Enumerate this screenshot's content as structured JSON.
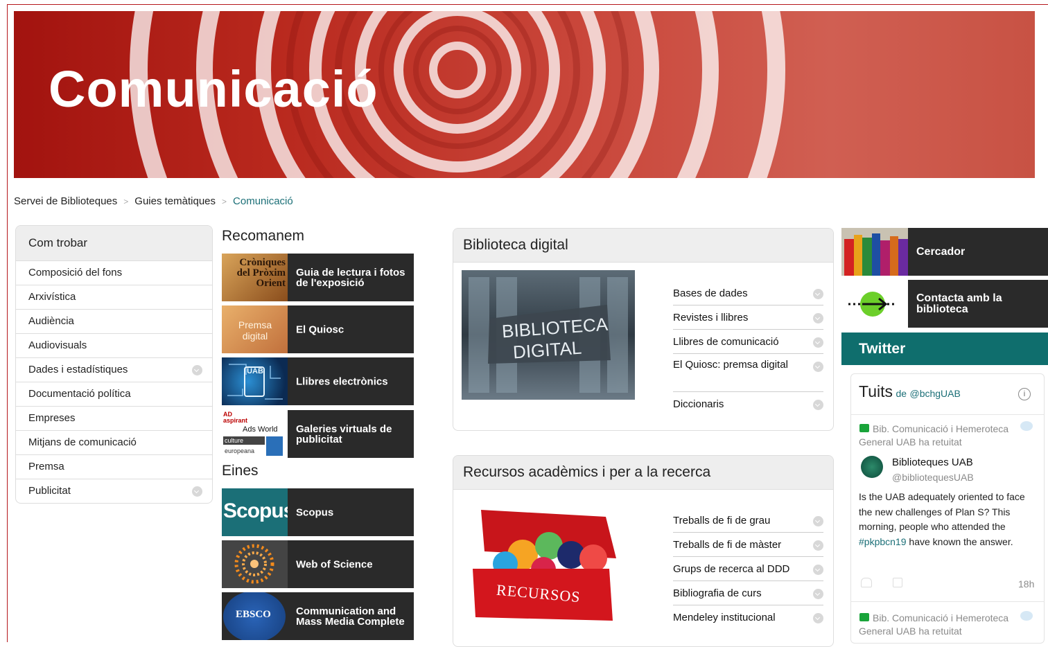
{
  "banner": {
    "title": "Comunicació"
  },
  "breadcrumb": {
    "items": [
      "Servei de Biblioteques",
      "Guies temàtiques",
      "Comunicació"
    ]
  },
  "sidebar": {
    "heading": "Com trobar",
    "items": [
      {
        "label": "Composició del fons",
        "expandable": false
      },
      {
        "label": "Arxivística",
        "expandable": false
      },
      {
        "label": "Audiència",
        "expandable": false
      },
      {
        "label": "Audiovisuals",
        "expandable": false
      },
      {
        "label": "Dades i estadístiques",
        "expandable": true
      },
      {
        "label": "Documentació política",
        "expandable": false
      },
      {
        "label": "Empreses",
        "expandable": false
      },
      {
        "label": "Mitjans de comunicació",
        "expandable": false
      },
      {
        "label": "Premsa",
        "expandable": false
      },
      {
        "label": "Publicitat",
        "expandable": true
      }
    ]
  },
  "recomanem": {
    "heading": "Recomanem",
    "thumb_text": [
      "Cròniques del Pròxim Orient",
      "Premsa digital",
      "UAB"
    ],
    "tiles": [
      "Guia de lectura i fotos de l'exposició",
      "El Quiosc",
      "Llibres electrònics",
      "Galeries virtuals de publicitat"
    ]
  },
  "galeries_thumb": [
    "AD aspirant",
    "Ads World",
    "culture",
    "europeana"
  ],
  "eines": {
    "heading": "Eines",
    "scopus_logo": "Scopus",
    "ebsco_logo": "EBSCO",
    "tiles": [
      "Scopus",
      "Web of Science",
      "Communication and Mass Media Complete"
    ]
  },
  "biblioteca_digital": {
    "heading": "Biblioteca digital",
    "image_text": [
      "BIBLIOTECA",
      "DIGITAL"
    ],
    "links": [
      "Bases de dades",
      "Revistes i llibres",
      "Llibres de comunicació",
      "El Quiosc: premsa digital",
      "Diccionaris"
    ]
  },
  "recursos": {
    "heading": "Recursos acadèmics i per a la recerca",
    "image_text": "RECURSOS",
    "links": [
      "Treballs de fi de grau",
      "Treballs de fi de màster",
      "Grups de recerca al DDD",
      "Bibliografia de curs",
      "Mendeley institucional"
    ]
  },
  "right": {
    "cercador": "Cercador",
    "contacta": "Contacta amb la biblioteca",
    "twitter_label": "Twitter"
  },
  "twitter": {
    "title": "Tuits",
    "by": "de",
    "handle": "@bchgUAB",
    "tweets": [
      {
        "retweet_note": "Bib. Comunicació i Hemeroteca General UAB ha retuitat",
        "author": "Biblioteques UAB",
        "author_handle": "@bibliotequesUAB",
        "text_before": "Is the UAB adequately oriented to face the new challenges of Plan S? This morning, people who attended the ",
        "hashtag": "#pkpbcn19",
        "text_after": " have known the answer.",
        "time": "18h"
      },
      {
        "retweet_note": "Bib. Comunicació i Hemeroteca General UAB ha retuitat"
      }
    ]
  },
  "colors": {
    "brand_red": "#b5161b",
    "twitter_bar": "#0f6e6d",
    "tile_dark": "#2a2a2a",
    "link_teal": "#1b6f77"
  }
}
